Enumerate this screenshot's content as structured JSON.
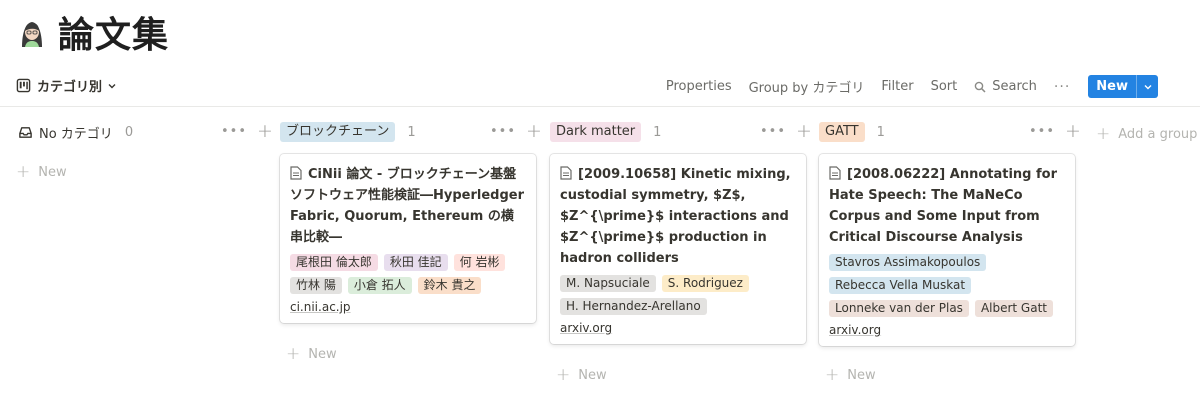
{
  "page": {
    "title": "論文集",
    "icon": "woman-face-icon"
  },
  "toolbar": {
    "view_label": "カテゴリ別",
    "properties": "Properties",
    "group_by": "Group by カテゴリ",
    "filter": "Filter",
    "sort": "Sort",
    "search": "Search",
    "more": "···",
    "new_label": "New"
  },
  "colors": {
    "accent": "#2383e2",
    "blockchain_tag": "#d3e5ef",
    "dark_matter_tag": "#f5e0e9",
    "gatt_tag": "#fadec9",
    "tag_pink": "#f5dbe4",
    "tag_purple": "#e8deee",
    "tag_red": "#ffe2dd",
    "tag_gray": "#e3e2e0",
    "tag_green": "#dbeddb",
    "tag_orange": "#fadec9",
    "tag_yellow": "#fdecc8",
    "tag_blue": "#d3e5ef",
    "tag_brown": "#eee0da"
  },
  "groups": [
    {
      "label": "No カテゴリ",
      "count": "0",
      "new_label": "New"
    },
    {
      "label": "ブロックチェーン",
      "count": "1",
      "new_label": "New",
      "card": {
        "title": "CiNii 論文 - ブロックチェーン基盤ソフトウェア性能検証―Hyperledger Fabric, Quorum, Ethereum の横串比較―",
        "tags": [
          {
            "text": "尾根田 倫太郎",
            "color": "#f5dbe4"
          },
          {
            "text": "秋田 佳記",
            "color": "#e8deee"
          },
          {
            "text": "何 岩彬",
            "color": "#ffe2dd"
          },
          {
            "text": "竹林 陽",
            "color": "#e3e2e0"
          },
          {
            "text": "小倉 拓人",
            "color": "#dbeddb"
          },
          {
            "text": "鈴木 貴之",
            "color": "#fadec9"
          }
        ],
        "url": "ci.nii.ac.jp"
      }
    },
    {
      "label": "Dark matter",
      "count": "1",
      "new_label": "New",
      "card": {
        "title": "[2009.10658] Kinetic mixing, custodial symmetry, $Z$, $Z^{\\prime}$ interactions and $Z^{\\prime}$ production in hadron colliders",
        "tags": [
          {
            "text": "M. Napsuciale",
            "color": "#e3e2e0"
          },
          {
            "text": "S. Rodriguez",
            "color": "#fdecc8"
          },
          {
            "text": "H. Hernandez-Arellano",
            "color": "#e3e2e0"
          }
        ],
        "url": "arxiv.org"
      }
    },
    {
      "label": "GATT",
      "count": "1",
      "new_label": "New",
      "card": {
        "title": "[2008.06222] Annotating for Hate Speech: The MaNeCo Corpus and Some Input from Critical Discourse Analysis",
        "tags": [
          {
            "text": "Stavros Assimakopoulos",
            "color": "#d3e5ef"
          },
          {
            "text": "Rebecca Vella Muskat",
            "color": "#d3e5ef"
          },
          {
            "text": "Lonneke van der Plas",
            "color": "#eee0da"
          },
          {
            "text": "Albert Gatt",
            "color": "#eee0da"
          }
        ],
        "url": "arxiv.org"
      }
    }
  ],
  "add_group_label": "Add a group"
}
